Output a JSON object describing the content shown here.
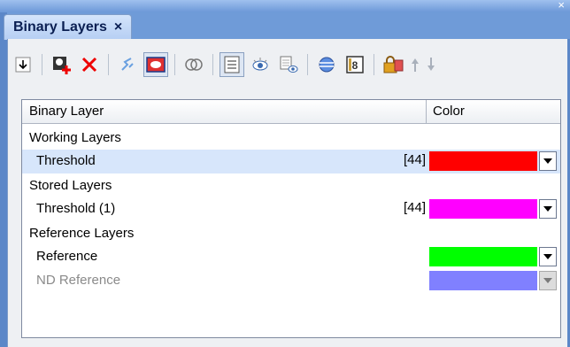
{
  "window": {
    "close_glyph": "×"
  },
  "tab": {
    "title": "Binary Layers",
    "close_glyph": "×"
  },
  "toolbar": {
    "buttons": [
      {
        "name": "import-arrow-icon",
        "glyph": "↓"
      },
      {
        "name": "add-layer-icon",
        "glyph": ""
      },
      {
        "name": "delete-layer-icon",
        "glyph": "✕"
      },
      {
        "name": "wand-icon",
        "glyph": "⚡"
      },
      {
        "name": "fill-region-icon",
        "glyph": ""
      },
      {
        "name": "intersect-icon",
        "glyph": "⊕"
      },
      {
        "name": "list-view-icon",
        "glyph": "☰"
      },
      {
        "name": "visibility-icon",
        "glyph": "👁"
      },
      {
        "name": "layer-visibility-icon",
        "glyph": ""
      },
      {
        "name": "sphere-icon",
        "glyph": "⊜"
      },
      {
        "name": "b8-icon",
        "glyph": "8"
      },
      {
        "name": "lock-icon",
        "glyph": ""
      },
      {
        "name": "move-up-icon",
        "glyph": "▲"
      },
      {
        "name": "move-down-icon",
        "glyph": "▼"
      }
    ]
  },
  "table": {
    "col_layer": "Binary Layer",
    "col_color": "Color"
  },
  "groups": {
    "working": "Working Layers",
    "stored": "Stored Layers",
    "reference": "Reference Layers"
  },
  "rows": {
    "threshold": {
      "label": "Threshold",
      "count": "[44]",
      "color": "#ff0000"
    },
    "threshold1": {
      "label": "Threshold (1)",
      "count": "[44]",
      "color": "#ff00ff"
    },
    "reference": {
      "label": "Reference",
      "color": "#00ff00"
    },
    "nd_reference": {
      "label": "ND Reference",
      "color": "#8080ff"
    }
  },
  "colors": {
    "selected_row": "#d7e6fb"
  }
}
